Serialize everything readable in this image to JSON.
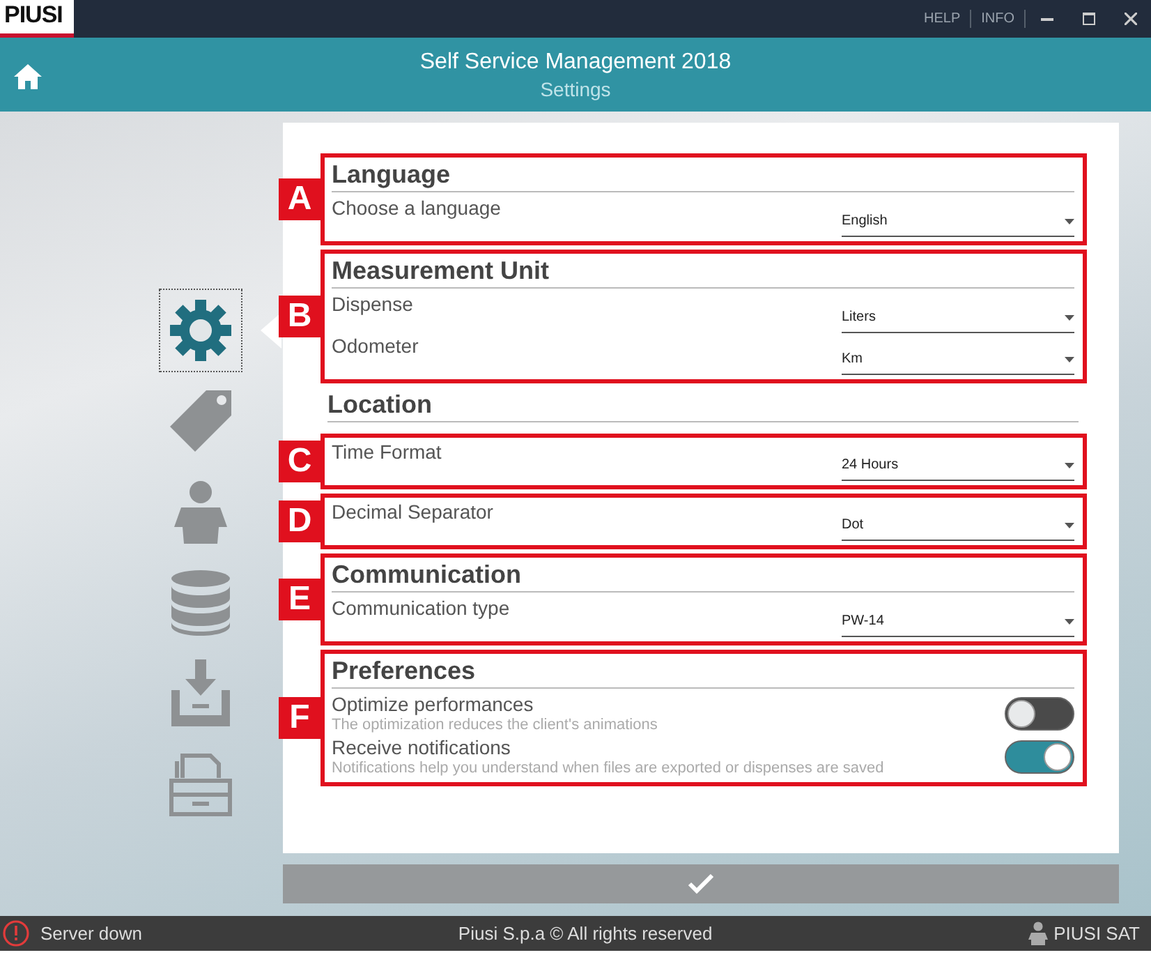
{
  "title_bar": {
    "logo": "PIUSI",
    "links": [
      "HELP",
      "INFO"
    ]
  },
  "header": {
    "title": "Self Service Management 2018",
    "subtitle": "Settings"
  },
  "sidebar": {
    "items": [
      {
        "kind": "gear",
        "selected": true
      },
      {
        "kind": "tag",
        "selected": false
      },
      {
        "kind": "person",
        "selected": false
      },
      {
        "kind": "database",
        "selected": false
      },
      {
        "kind": "inbox",
        "selected": false
      },
      {
        "kind": "archive",
        "selected": false
      }
    ]
  },
  "sections": [
    {
      "marker": "A",
      "heading": "Language",
      "rows": [
        {
          "kind": "select",
          "label": "Choose a language",
          "value": "English"
        }
      ]
    },
    {
      "marker": "B",
      "heading": "Measurement Unit",
      "rows": [
        {
          "kind": "select",
          "label": "Dispense",
          "value": "Liters"
        },
        {
          "kind": "select",
          "label": "Odometer",
          "value": "Km"
        }
      ]
    },
    {
      "heading": "Location"
    },
    {
      "marker": "C",
      "rows": [
        {
          "kind": "select",
          "label": "Time Format",
          "value": "24 Hours"
        }
      ]
    },
    {
      "marker": "D",
      "rows": [
        {
          "kind": "select",
          "label": "Decimal Separator",
          "value": "Dot"
        }
      ]
    },
    {
      "marker": "E",
      "heading": "Communication",
      "rows": [
        {
          "kind": "select",
          "label": "Communication type",
          "value": "PW-14"
        }
      ]
    },
    {
      "marker": "F",
      "heading": "Preferences",
      "rows": [
        {
          "kind": "toggle",
          "label": "Optimize performances",
          "description": "The optimization reduces the client's animations",
          "on": false
        },
        {
          "kind": "toggle",
          "label": "Receive notifications",
          "description": "Notifications help you understand when files are exported or dispenses are saved",
          "on": true
        }
      ]
    }
  ],
  "status_bar": {
    "status": "Server down",
    "copyright": "Piusi S.p.a © All rights reserved",
    "user": "PIUSI SAT"
  }
}
